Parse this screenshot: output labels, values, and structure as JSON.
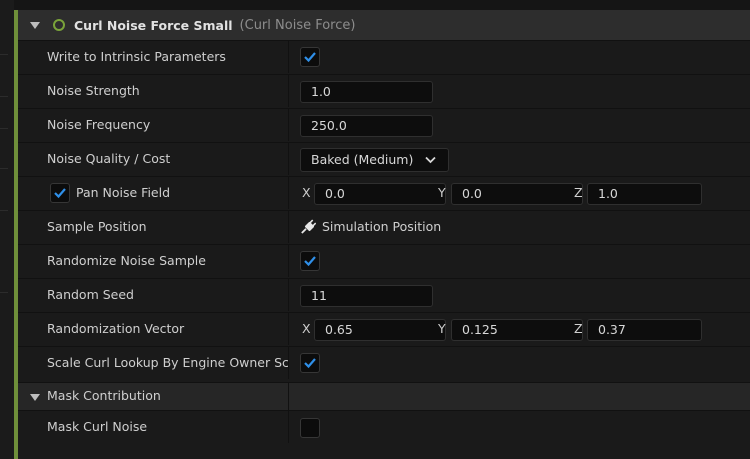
{
  "module": {
    "title": "Curl Noise Force Small",
    "subtitle": "(Curl Noise Force)",
    "accent_color": "#6f8f3a",
    "status_color": "#7aa33a"
  },
  "rows": {
    "write_intrinsic": {
      "label": "Write to Intrinsic Parameters",
      "checked": true
    },
    "noise_strength": {
      "label": "Noise Strength",
      "value": "1.0"
    },
    "noise_frequency": {
      "label": "Noise Frequency",
      "value": "250.0"
    },
    "noise_quality": {
      "label": "Noise Quality / Cost",
      "value": "Baked (Medium)"
    },
    "pan_noise_field": {
      "label": "Pan Noise Field",
      "checked": true,
      "x_label": "X",
      "x": "0.0",
      "y_label": "Y",
      "y": "0.0",
      "z_label": "Z",
      "z": "1.0"
    },
    "sample_position": {
      "label": "Sample Position",
      "value": "Simulation Position",
      "icon": "plug-icon"
    },
    "randomize_noise_sample": {
      "label": "Randomize Noise Sample",
      "checked": true
    },
    "random_seed": {
      "label": "Random Seed",
      "value": "11"
    },
    "randomization_vector": {
      "label": "Randomization Vector",
      "x_label": "X",
      "x": "0.65",
      "y_label": "Y",
      "y": "0.125",
      "z_label": "Z",
      "z": "0.37"
    },
    "scale_curl_lookup": {
      "label": "Scale Curl Lookup By Engine Owner Sc",
      "checked": true
    },
    "mask_contribution": {
      "label": "Mask Contribution"
    },
    "mask_curl_noise": {
      "label": "Mask Curl Noise",
      "checked": false
    }
  },
  "colors": {
    "check": "#2f8fe8",
    "panel": "#1a1a1a",
    "header": "#2d2d2d"
  }
}
